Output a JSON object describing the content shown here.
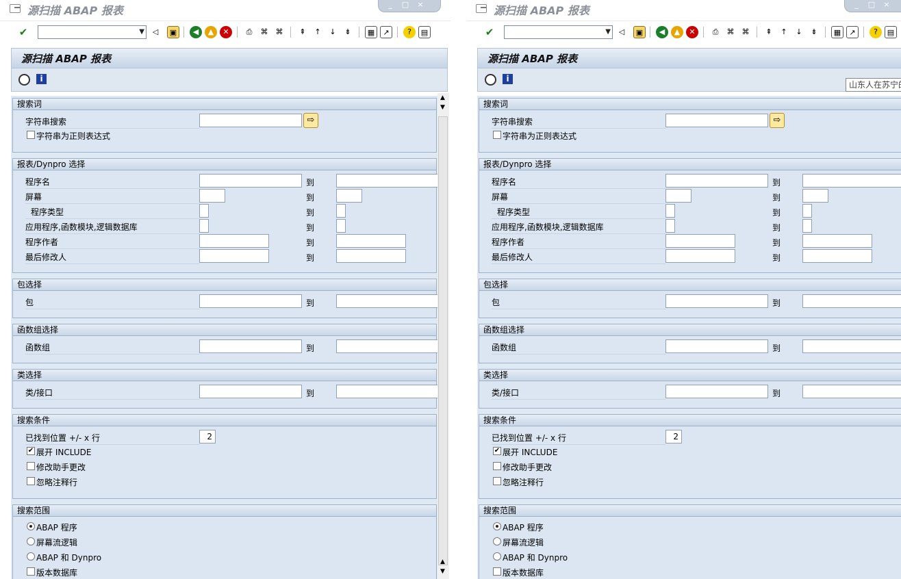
{
  "window": {
    "title": "源扫描 ABAP 报表"
  },
  "screen": {
    "title": "源扫描 ABAP 报表"
  },
  "command_field": {
    "value": ""
  },
  "tooltip": "山东人在苏宁的",
  "groups": {
    "search_term": {
      "title": "搜索词",
      "string_search_label": "字符串搜索",
      "regex_label": "字符串为正则表达式"
    },
    "report_selection": {
      "title": "报表/Dynpro 选择",
      "rows": [
        "程序名",
        "屏幕",
        "程序类型",
        "应用程序,函数模块,逻辑数据库",
        "程序作者",
        "最后修改人"
      ],
      "to": "到"
    },
    "package": {
      "title": "包选择",
      "label": "包",
      "to": "到"
    },
    "function_group": {
      "title": "函数组选择",
      "label": "函数组",
      "to": "到"
    },
    "class": {
      "title": "类选择",
      "label": "类/接口",
      "to": "到"
    },
    "search_conditions": {
      "title": "搜索条件",
      "lines_label": "已找到位置 +/- x 行",
      "lines_value": "2",
      "include_label": "展开 INCLUDE",
      "include_checked": true,
      "mod_label": "修改助手更改",
      "comments_label": "忽略注释行"
    },
    "search_scope": {
      "title": "搜索范围",
      "opt_abap": "ABAP 程序",
      "opt_flow": "屏幕流逻辑",
      "opt_both": "ABAP 和 Dynpro",
      "version_label": "版本数据库",
      "selected": "ABAP 程序"
    }
  },
  "colors": {
    "accent": "#1f3f9e",
    "panel": "#dbe6f2",
    "header": "#c6d4e6"
  }
}
